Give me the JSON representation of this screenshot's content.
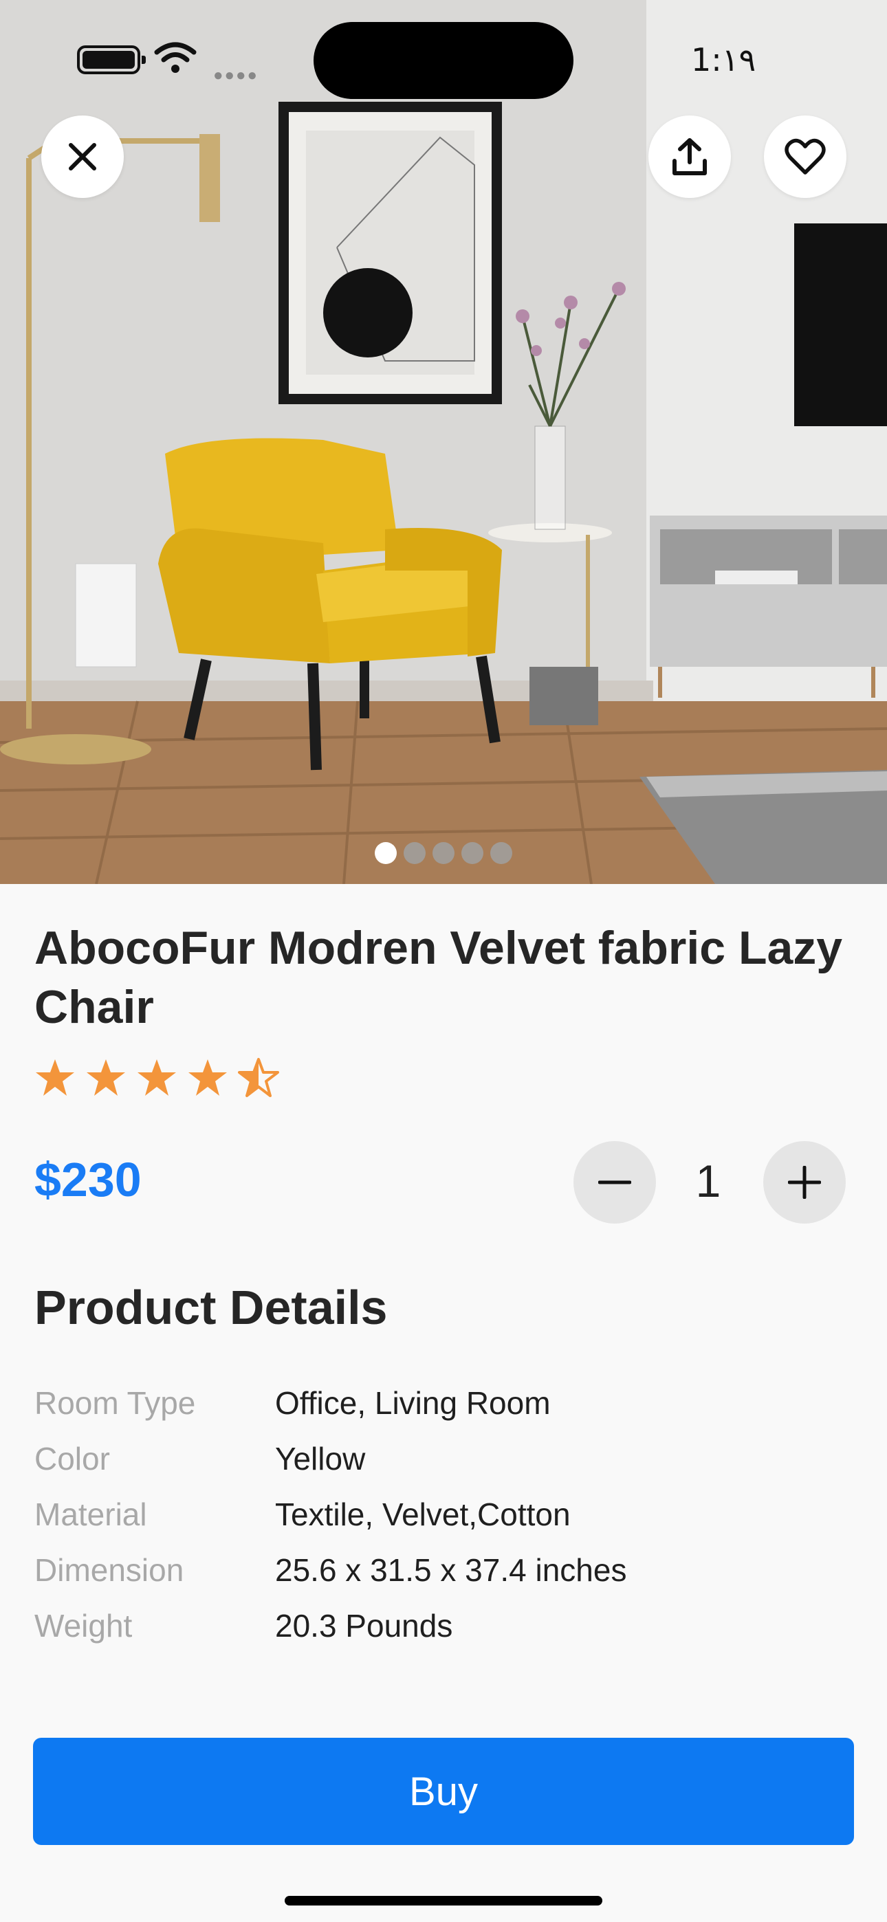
{
  "status_bar": {
    "time": "1:١٩"
  },
  "actions": {
    "close": "close",
    "share": "share",
    "favorite": "favorite"
  },
  "carousel": {
    "count": 5,
    "active_index": 0
  },
  "product": {
    "title": "AbocoFur Modren Velvet fabric Lazy Chair",
    "rating": 4.5,
    "rating_max": 5,
    "price": "$230",
    "quantity": "1"
  },
  "details": {
    "heading": "Product Details",
    "rows": [
      {
        "label": "Room Type",
        "value": "Office, Living Room"
      },
      {
        "label": "Color",
        "value": "Yellow"
      },
      {
        "label": "Material",
        "value": "Textile, Velvet,Cotton"
      },
      {
        "label": "Dimension",
        "value": "25.6 x 31.5 x 37.4 inches"
      },
      {
        "label": "Weight",
        "value": "20.3 Pounds"
      }
    ]
  },
  "buy_button": {
    "label": "Buy"
  },
  "colors": {
    "accent": "#0d79f2",
    "price": "#1a7cf5",
    "star": "#f3953b"
  },
  "icons": {
    "close": "close-icon",
    "share": "share-icon",
    "favorite": "heart-icon",
    "minus": "minus-icon",
    "plus": "plus-icon",
    "star": "star-icon"
  }
}
